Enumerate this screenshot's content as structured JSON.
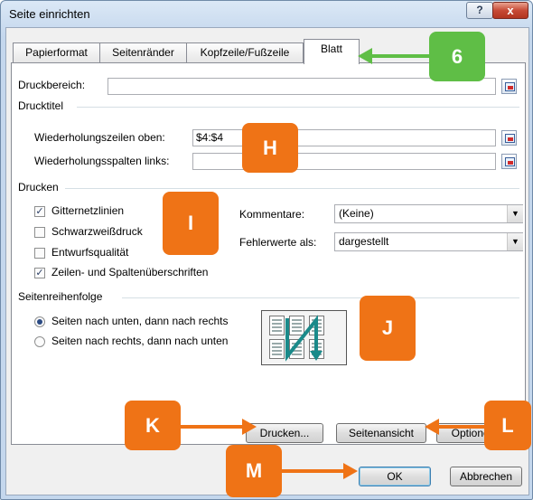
{
  "window": {
    "title": "Seite einrichten",
    "help_label": "?",
    "close_label": "x"
  },
  "tabs": [
    {
      "label": "Papierformat",
      "active": false
    },
    {
      "label": "Seitenränder",
      "active": false
    },
    {
      "label": "Kopfzeile/Fußzeile",
      "active": false
    },
    {
      "label": "Blatt",
      "active": true
    }
  ],
  "print_area": {
    "label": "Druckbereich:",
    "value": ""
  },
  "print_titles": {
    "group_label": "Drucktitel",
    "rows_label": "Wiederholungszeilen oben:",
    "rows_value": "$4:$4",
    "cols_label": "Wiederholungsspalten links:",
    "cols_value": ""
  },
  "print": {
    "group_label": "Drucken",
    "checkboxes": [
      {
        "label": "Gitternetzlinien",
        "checked": true
      },
      {
        "label": "Schwarzweißdruck",
        "checked": false
      },
      {
        "label": "Entwurfsqualität",
        "checked": false
      },
      {
        "label": "Zeilen- und Spaltenüberschriften",
        "checked": true
      }
    ],
    "comments_label": "Kommentare:",
    "comments_value": "(Keine)",
    "errors_label": "Fehlerwerte als:",
    "errors_value": "dargestellt"
  },
  "page_order": {
    "group_label": "Seitenreihenfolge",
    "options": [
      {
        "label": "Seiten nach unten, dann nach rechts",
        "selected": true
      },
      {
        "label": "Seiten nach rechts, dann nach unten",
        "selected": false
      }
    ]
  },
  "buttons": {
    "print": "Drucken...",
    "preview": "Seitenansicht",
    "options": "Optionen...",
    "ok": "OK",
    "cancel": "Abbrechen"
  },
  "annotations": [
    {
      "id": "6",
      "color": "#5fbe46"
    },
    {
      "id": "H",
      "color": "#ef7316"
    },
    {
      "id": "I",
      "color": "#ef7316"
    },
    {
      "id": "J",
      "color": "#ef7316"
    },
    {
      "id": "K",
      "color": "#ef7316"
    },
    {
      "id": "L",
      "color": "#ef7316"
    },
    {
      "id": "M",
      "color": "#ef7316"
    }
  ]
}
